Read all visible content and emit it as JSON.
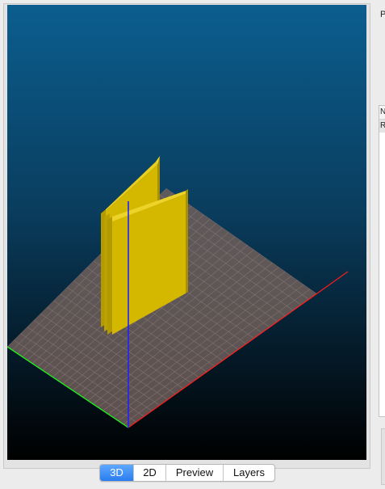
{
  "colors": {
    "viewport_top": "#0b5e8f",
    "viewport_bottom": "#000000",
    "bed": "#6e5e5b",
    "grid": "#8a7a76",
    "model": "#d4b800",
    "model_dark": "#b39a00",
    "axis_x": "#ff1a1a",
    "axis_y": "#1aff1a",
    "axis_z": "#2020ff",
    "tab_active": "#2a7df0"
  },
  "view_tabs": [
    {
      "label": "3D",
      "active": true
    },
    {
      "label": "2D",
      "active": false
    },
    {
      "label": "Preview",
      "active": false
    },
    {
      "label": "Layers",
      "active": false
    }
  ],
  "side_panel": {
    "label": "P",
    "list_header": "N",
    "list_row": "R"
  }
}
